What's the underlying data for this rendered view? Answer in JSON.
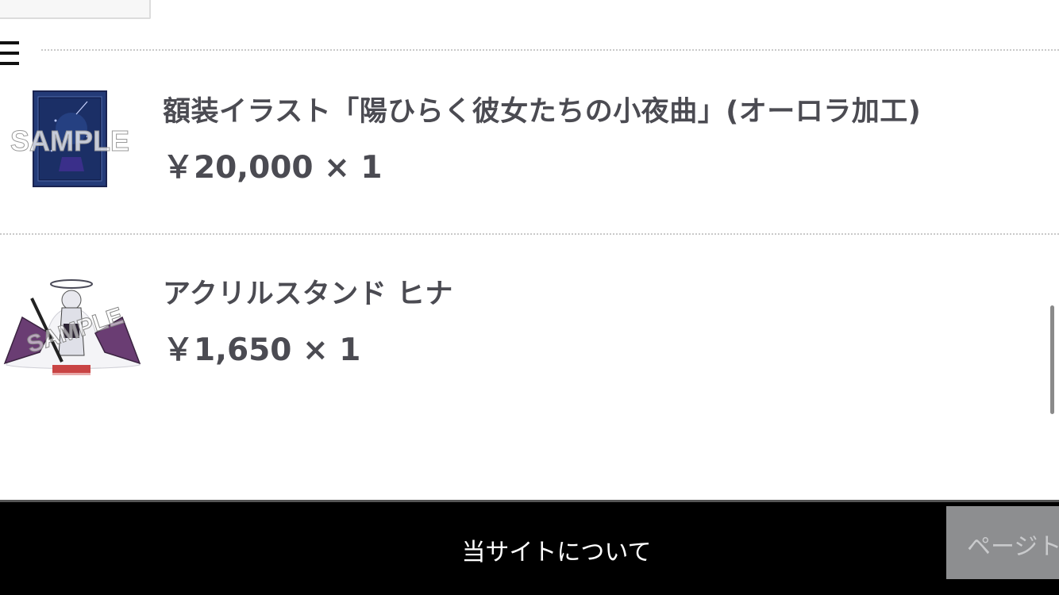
{
  "menu": {
    "icon": "hamburger-menu-icon"
  },
  "cart_items": [
    {
      "title": "額装イラスト「陽ひらく彼女たちの小夜曲」(オーロラ加工)",
      "price": "￥20,000 × 1",
      "thumbnail_watermark": "SAMPLE",
      "thumbnail_icon": "framed-illustration-thumbnail"
    },
    {
      "title": "アクリルスタンド ヒナ",
      "price": "￥1,650 × 1",
      "thumbnail_watermark": "SAMPLE",
      "thumbnail_icon": "acrylic-stand-thumbnail"
    }
  ],
  "footer": {
    "about_link": "当サイトについて",
    "page_top_button": "ページト"
  },
  "colors": {
    "footer_background": "#000000",
    "text": "#4b4b52",
    "page_top_button": "#8d8e90"
  }
}
